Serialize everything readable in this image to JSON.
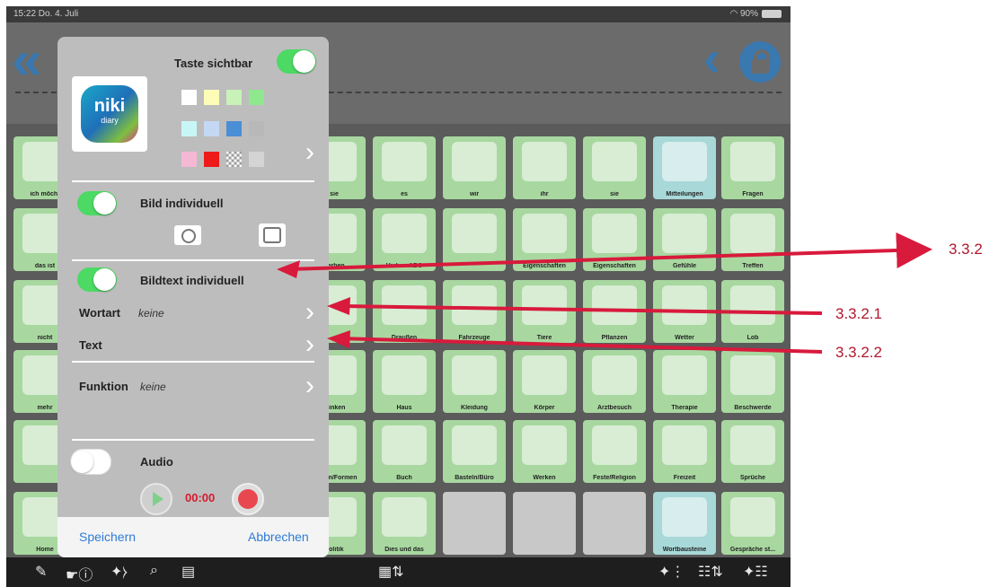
{
  "status": {
    "time_date": "15:22  Do. 4. Juli",
    "battery": "90%"
  },
  "grid": {
    "rows": [
      [
        {
          "label": "ich möcht",
          "color": "#a8d8a0"
        },
        {
          "label": "",
          "color": "#a8d8a0"
        },
        {
          "label": "",
          "color": "#a8d8a0"
        },
        {
          "label": "",
          "color": "#a8d8a0"
        },
        {
          "label": "sie",
          "color": "#a8d8a0"
        },
        {
          "label": "es",
          "color": "#a8d8a0"
        },
        {
          "label": "wir",
          "color": "#a8d8a0"
        },
        {
          "label": "ihr",
          "color": "#a8d8a0"
        },
        {
          "label": "sie",
          "color": "#a8d8a0"
        },
        {
          "label": "Mitteilungen",
          "color": "#a8d8d8"
        },
        {
          "label": "Fragen",
          "color": "#a8d8a0"
        }
      ],
      [
        {
          "label": "das ist",
          "color": "#a8d8a0"
        },
        {
          "label": "",
          "color": "#a8d8a0"
        },
        {
          "label": "",
          "color": "#a8d8a0"
        },
        {
          "label": "",
          "color": "#a8d8a0"
        },
        {
          "label": "Verben",
          "color": "#a8d8a0"
        },
        {
          "label": "Verben ABC",
          "color": "#a8d8a0"
        },
        {
          "label": "",
          "color": "#a8d8a0"
        },
        {
          "label": "Eigenschaften",
          "color": "#a8d8a0"
        },
        {
          "label": "Eigenschaften",
          "color": "#a8d8a0"
        },
        {
          "label": "Gefühle",
          "color": "#a8d8a0"
        },
        {
          "label": "Treffen",
          "color": "#a8d8a0"
        }
      ],
      [
        {
          "label": "nicht",
          "color": "#a8d8a0"
        },
        {
          "label": "",
          "color": "#a8d8a0"
        },
        {
          "label": "",
          "color": "#a8d8a0"
        },
        {
          "label": "",
          "color": "#a8d8a0"
        },
        {
          "label": "",
          "color": "#a8d8a0"
        },
        {
          "label": "Draußen",
          "color": "#a8d8a0"
        },
        {
          "label": "Fahrzeuge",
          "color": "#a8d8a0"
        },
        {
          "label": "Tiere",
          "color": "#a8d8a0"
        },
        {
          "label": "Pflanzen",
          "color": "#a8d8a0"
        },
        {
          "label": "Wetter",
          "color": "#a8d8a0"
        },
        {
          "label": "Lob",
          "color": "#a8d8a0"
        }
      ],
      [
        {
          "label": "mehr",
          "color": "#a8d8a0"
        },
        {
          "label": "",
          "color": "#a8d8a0"
        },
        {
          "label": "",
          "color": "#a8d8a0"
        },
        {
          "label": "",
          "color": "#a8d8a0"
        },
        {
          "label": "Trinken",
          "color": "#a8d8a0"
        },
        {
          "label": "Haus",
          "color": "#a8d8a0"
        },
        {
          "label": "Kleidung",
          "color": "#a8d8a0"
        },
        {
          "label": "Körper",
          "color": "#a8d8a0"
        },
        {
          "label": "Arztbesuch",
          "color": "#a8d8a0"
        },
        {
          "label": "Therapie",
          "color": "#a8d8a0"
        },
        {
          "label": "Beschwerde",
          "color": "#a8d8a0"
        }
      ],
      [
        {
          "label": "",
          "color": "#a8d8a0"
        },
        {
          "label": "",
          "color": "#a8d8a0"
        },
        {
          "label": "",
          "color": "#a8d8a0"
        },
        {
          "label": "",
          "color": "#a8d8a0"
        },
        {
          "label": "Farben/Formen",
          "color": "#a8d8a0"
        },
        {
          "label": "Buch",
          "color": "#a8d8a0"
        },
        {
          "label": "Basteln/Büro",
          "color": "#a8d8a0"
        },
        {
          "label": "Werken",
          "color": "#a8d8a0"
        },
        {
          "label": "Feste/Religion",
          "color": "#a8d8a0"
        },
        {
          "label": "Freizeit",
          "color": "#a8d8a0"
        },
        {
          "label": "Sprüche",
          "color": "#a8d8a0"
        }
      ],
      [
        {
          "label": "Home",
          "color": "#a8d8a0"
        },
        {
          "label": "",
          "color": "#a8d8a0"
        },
        {
          "label": "",
          "color": "#a8d8a0"
        },
        {
          "label": "",
          "color": "#a8d8a0"
        },
        {
          "label": "Politik",
          "color": "#a8d8a0"
        },
        {
          "label": "Dies und das",
          "color": "#a8d8a0"
        },
        {
          "label": "",
          "color": "#c8c8c8"
        },
        {
          "label": "",
          "color": "#c8c8c8"
        },
        {
          "label": "",
          "color": "#c8c8c8"
        },
        {
          "label": "Wortbausteine",
          "color": "#a8d8d8"
        },
        {
          "label": "Gespräche st...",
          "color": "#a8d8a0"
        }
      ]
    ]
  },
  "dialog": {
    "taste_sichtbar": "Taste sichtbar",
    "logo_line1": "niki",
    "logo_line2": "diary",
    "bild_individuell": "Bild individuell",
    "bildtext_individuell": "Bildtext individuell",
    "wortart_label": "Wortart",
    "wortart_value": "keine",
    "text_label": "Text",
    "funktion_label": "Funktion",
    "funktion_value": "keine",
    "audio_label": "Audio",
    "audio_time": "00:00",
    "save": "Speichern",
    "cancel": "Abbrechen",
    "swatches": [
      "#ffffff",
      "#fdfdb8",
      "#c8f2b8",
      "#8ee88e",
      "#c8f6f6",
      "#c4d8f4",
      "#4a8ed6",
      "#b8b8b8",
      "#f4b8d4",
      "#ee1a1a",
      "checker",
      "#d4d4d4"
    ]
  },
  "callouts": {
    "c1": "3.3.2",
    "c2": "3.3.2.1",
    "c3": "3.3.2.2"
  },
  "colors": {
    "accent_red": "#d81a3c",
    "ios_blue": "#2e7bd6",
    "toggle_green": "#4cd964"
  }
}
